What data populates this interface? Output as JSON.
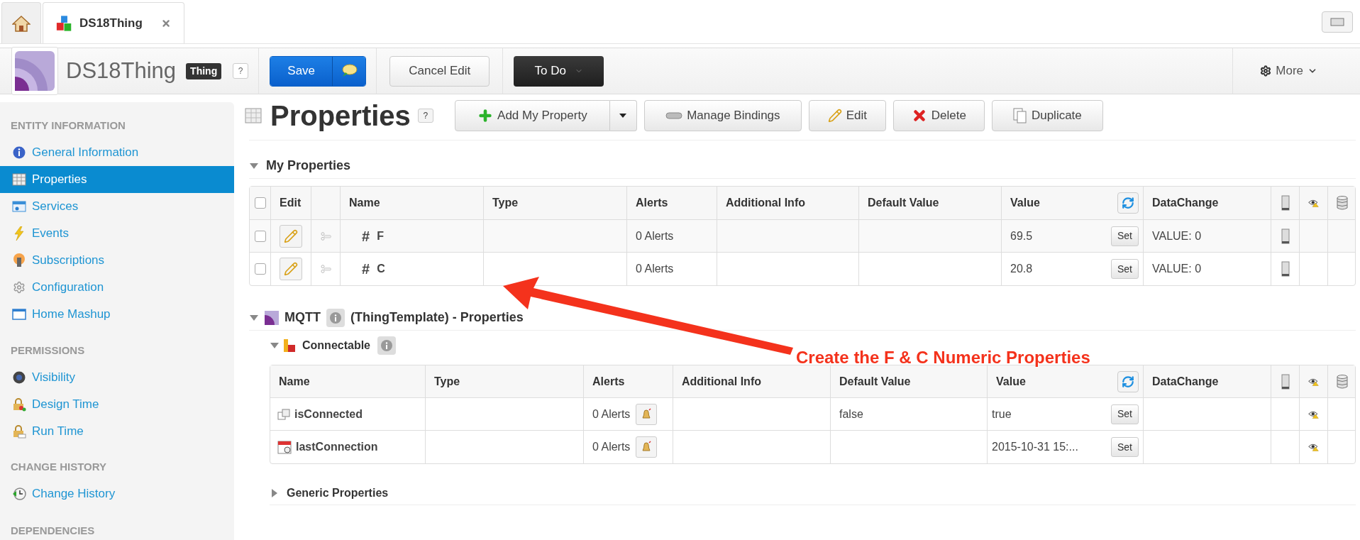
{
  "tabs": [
    {
      "kind": "home",
      "selected": false
    },
    {
      "kind": "entity",
      "label": "DS18Thing",
      "selected": true
    }
  ],
  "header": {
    "title": "DS18Thing",
    "badge": "Thing",
    "help": "?",
    "save": "Save",
    "cancel": "Cancel Edit",
    "todo": "To Do",
    "more": "More"
  },
  "sidebar": [
    {
      "heading": "ENTITY INFORMATION",
      "items": [
        {
          "label": "General Information",
          "selected": false
        },
        {
          "label": "Properties",
          "selected": true
        },
        {
          "label": "Services",
          "selected": false
        },
        {
          "label": "Events",
          "selected": false
        },
        {
          "label": "Subscriptions",
          "selected": false
        },
        {
          "label": "Configuration",
          "selected": false
        },
        {
          "label": "Home Mashup",
          "selected": false
        }
      ]
    },
    {
      "heading": "PERMISSIONS",
      "items": [
        {
          "label": "Visibility",
          "selected": false
        },
        {
          "label": "Design Time",
          "selected": false
        },
        {
          "label": "Run Time",
          "selected": false
        }
      ]
    },
    {
      "heading": "CHANGE HISTORY",
      "items": [
        {
          "label": "Change History",
          "selected": false
        }
      ]
    },
    {
      "heading": "DEPENDENCIES"
    }
  ],
  "page": {
    "title": "Properties",
    "help": "?",
    "actions": [
      "Add My Property",
      "Manage Bindings",
      "Edit",
      "Delete",
      "Duplicate"
    ]
  },
  "my_properties": {
    "title": "My Properties",
    "expanded": true,
    "select_all_checked": false,
    "columns": [
      "Edit",
      "Name",
      "Type",
      "Alerts",
      "Additional Info",
      "Default Value",
      "Value",
      "DataChange"
    ],
    "rows": [
      {
        "checked": false,
        "type_symbol": "#",
        "name": "F",
        "alerts": "0 Alerts",
        "value": "69.5",
        "action": "Set",
        "data_change": "VALUE: 0"
      },
      {
        "checked": false,
        "type_symbol": "#",
        "name": "C",
        "alerts": "0 Alerts",
        "value": "20.8",
        "action": "Set",
        "data_change": "VALUE: 0"
      }
    ]
  },
  "template": {
    "name": "MQTT",
    "suffix": "(ThingTemplate) - Properties",
    "expanded": true,
    "groups": [
      {
        "title": "Connectable",
        "expanded": true,
        "columns": [
          "Name",
          "Type",
          "Alerts",
          "Additional Info",
          "Default Value",
          "Value",
          "DataChange"
        ],
        "rows": [
          {
            "kind": "boolean",
            "name": "isConnected",
            "alerts": "0 Alerts",
            "default_value": "false",
            "value": "true",
            "action": "Set"
          },
          {
            "kind": "datetime",
            "name": "lastConnection",
            "alerts": "0 Alerts",
            "value": "2015-10-31 15:...",
            "action": "Set"
          }
        ]
      }
    ]
  },
  "generic_properties": {
    "title": "Generic Properties",
    "expanded": false
  },
  "annotation": {
    "text": "Create the F & C Numeric Properties"
  }
}
